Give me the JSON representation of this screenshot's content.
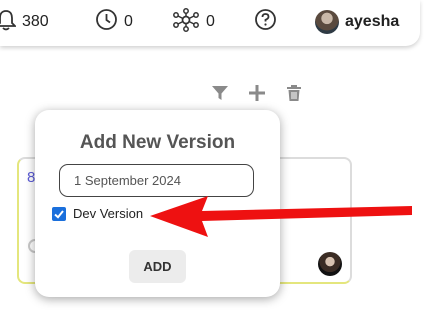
{
  "topbar": {
    "notifications_count": "380",
    "history_count": "0",
    "network_count": "0",
    "user_name": "ayesha",
    "icons": [
      "bell-icon",
      "clock-icon",
      "network-icon",
      "help-icon"
    ]
  },
  "toolbar": {
    "icons": [
      "filter-icon",
      "plus-icon",
      "trash-icon"
    ]
  },
  "card": {
    "label_fragment": "8"
  },
  "popup": {
    "title": "Add New Version",
    "date_value": "1 September 2024",
    "checkbox_label": "Dev Version",
    "checkbox_checked": true,
    "add_button_label": "ADD"
  },
  "colors": {
    "accent_blue": "#1a6fdc",
    "arrow_red": "#ee1111",
    "card_border_yellow": "#e4e67d"
  }
}
